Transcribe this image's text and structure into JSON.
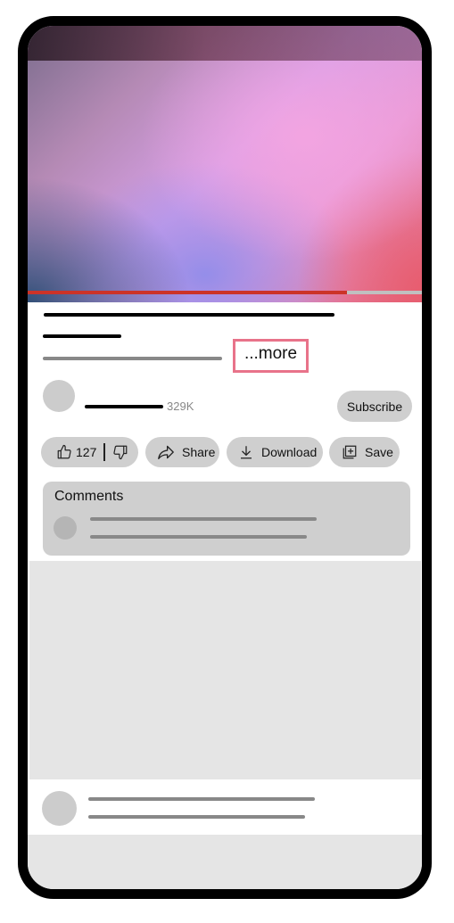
{
  "video": {
    "progress_percent": 81,
    "colors": {
      "progress_fill": "#cc3328",
      "progress_track": "#c0c0c0"
    }
  },
  "description": {
    "more_label": "...more",
    "more_highlight_color": "#e8738a"
  },
  "channel": {
    "subscriber_count": "329K",
    "subscribe_label": "Subscribe"
  },
  "actions": {
    "like_count": "127",
    "share_label": "Share",
    "download_label": "Download",
    "save_label": "Save",
    "icons": [
      "thumbs-up-icon",
      "thumbs-down-icon",
      "share-icon",
      "download-icon",
      "save-playlist-icon"
    ]
  },
  "comments": {
    "title": "Comments"
  }
}
